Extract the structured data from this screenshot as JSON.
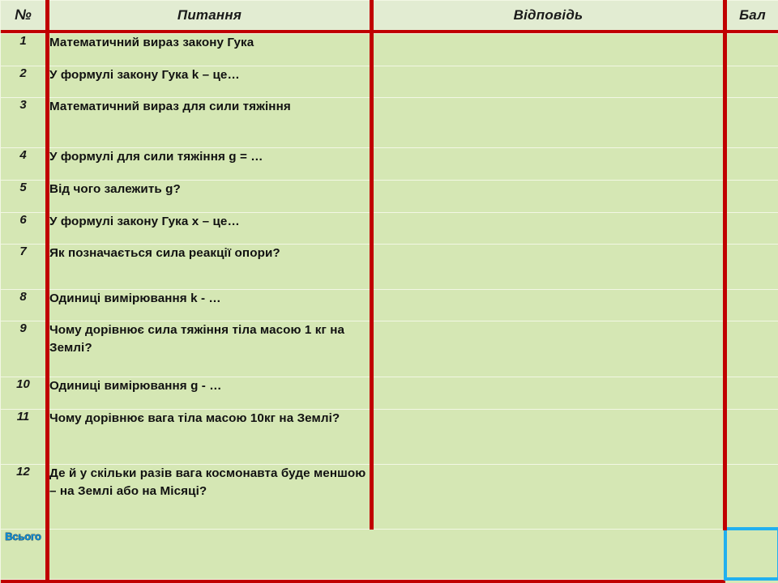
{
  "document": {
    "kind": "worksheet-table",
    "language": "uk"
  },
  "colors": {
    "cell_background": "#d5e7b4",
    "header_background": "#e2ecd2",
    "rule_red": "#c00000",
    "selection_blue": "#21b0ef",
    "total_text_blue": "#0f8fdb",
    "gridline": "#f2f7e4",
    "text": "#111111"
  },
  "table": {
    "headers": {
      "number": "№",
      "question": "Питання",
      "answer": "Відповідь",
      "score": "Бал"
    },
    "rows": [
      {
        "n": "1",
        "question": "Математичний  вираз  закону  Гука",
        "answer": "",
        "score": ""
      },
      {
        "n": "2",
        "question": "У формулі закону Гука k – це…",
        "answer": "",
        "score": ""
      },
      {
        "n": "3",
        "question": "Математичний  вираз  для  сили тяжіння",
        "answer": "",
        "score": ""
      },
      {
        "n": "4",
        "question": "У формулі для сили тяжіння  g = …",
        "answer": "",
        "score": ""
      },
      {
        "n": "5",
        "question": "Від чого залежить g?",
        "answer": "",
        "score": ""
      },
      {
        "n": "6",
        "question": "У формулі закону Гука x – це…",
        "answer": "",
        "score": ""
      },
      {
        "n": "7",
        "question": "Як позначається  сила реакції опори?",
        "answer": "",
        "score": ""
      },
      {
        "n": "8",
        "question": "Одиниці вимірювання  k - …",
        "answer": "",
        "score": ""
      },
      {
        "n": "9",
        "question": "Чому дорівнює сила тяжіння тіла масою 1 кг на Землі?",
        "answer": "",
        "score": ""
      },
      {
        "n": "10",
        "question": "Одиниці вимірювання  g - …",
        "answer": "",
        "score": ""
      },
      {
        "n": "11",
        "question": "Чому дорівнює вага тіла масою 10кг на Землі?",
        "answer": "",
        "score": ""
      },
      {
        "n": "12",
        "question": "Де й у скільки  разів  вага  космонавта  буде меншою – на Землі або на Місяці?",
        "answer": "",
        "score": ""
      }
    ],
    "totals": {
      "label": "Всього",
      "value": ""
    }
  }
}
